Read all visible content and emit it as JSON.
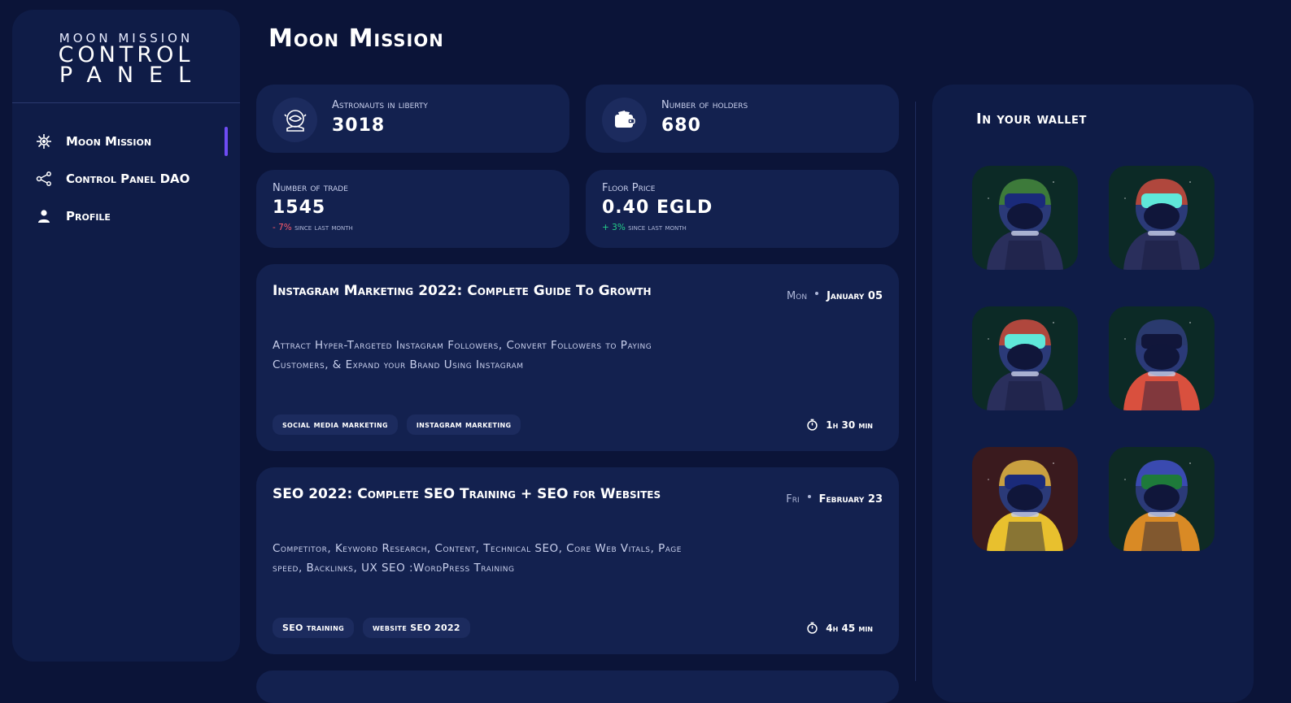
{
  "app": {
    "logo_line1": "MOON MISSION",
    "logo_line2": "CONTROL",
    "logo_line3": "PANEL"
  },
  "sidebar": {
    "items": [
      {
        "label": "Moon Mission",
        "icon": "virus-icon",
        "active": true
      },
      {
        "label": "Control Panel DAO",
        "icon": "share-nodes-icon",
        "active": false
      },
      {
        "label": "Profile",
        "icon": "user-icon",
        "active": false
      }
    ]
  },
  "header": {
    "title": "Moon Mission"
  },
  "stats": {
    "astronauts": {
      "label": "Astronauts in liberty",
      "value": "3018",
      "icon": "astronaut-helmet-icon"
    },
    "holders": {
      "label": "Number of holders",
      "value": "680",
      "icon": "wallet-icon"
    },
    "trade": {
      "label": "Number of trade",
      "value": "1545",
      "delta": "- 7%",
      "delta_text": "since last month"
    },
    "floor": {
      "label": "Floor Price",
      "value": "0.40 EGLD",
      "delta": "+ 3%",
      "delta_text": "since last month"
    }
  },
  "courses": [
    {
      "title": "Instagram Marketing 2022: Complete Guide To Growth",
      "day": "Mon",
      "date": "January 05",
      "description": "Attract Hyper-Targeted Instagram Followers, Convert Followers to Paying Customers, & Expand your Brand Using Instagram",
      "tags": [
        "social media marketing",
        "instagram marketing"
      ],
      "duration": "1h 30 min"
    },
    {
      "title": "SEO 2022: Complete SEO Training + SEO for Websites",
      "day": "Fri",
      "date": "February 23",
      "description": "Competitor, Keyword Research, Content, Technical SEO, Core Web Vitals, Page speed, Backlinks, UX SEO :WordPress Training",
      "tags": [
        "SEO training",
        "website SEO 2022"
      ],
      "duration": "4h 45 min"
    }
  ],
  "wallet": {
    "title": "In your wallet",
    "nfts": [
      {
        "name": "astronaut-nft-1",
        "bg": "#0c2a26",
        "helmet": "#3d7a3a",
        "visor": "#1a2a7a",
        "body": "#2a2f5c"
      },
      {
        "name": "astronaut-nft-2",
        "bg": "#0c2a26",
        "helmet": "#b0473d",
        "visor": "#5fe8d9",
        "body": "#2a2f5c"
      },
      {
        "name": "astronaut-nft-3",
        "bg": "#0c2a26",
        "helmet": "#b0473d",
        "visor": "#5fe8d9",
        "body": "#2a2f5c"
      },
      {
        "name": "astronaut-nft-4",
        "bg": "#0c2a26",
        "helmet": "#2a3a6e",
        "visor": "#11163a",
        "body": "#d9503e"
      },
      {
        "name": "astronaut-nft-5",
        "bg": "#3a1a1e",
        "helmet": "#c9a040",
        "visor": "#1a2a7a",
        "body": "#e8c02e"
      },
      {
        "name": "astronaut-nft-6",
        "bg": "#0e2a24",
        "helmet": "#3a4ab0",
        "visor": "#1e7a3a",
        "body": "#d98a25"
      }
    ]
  }
}
